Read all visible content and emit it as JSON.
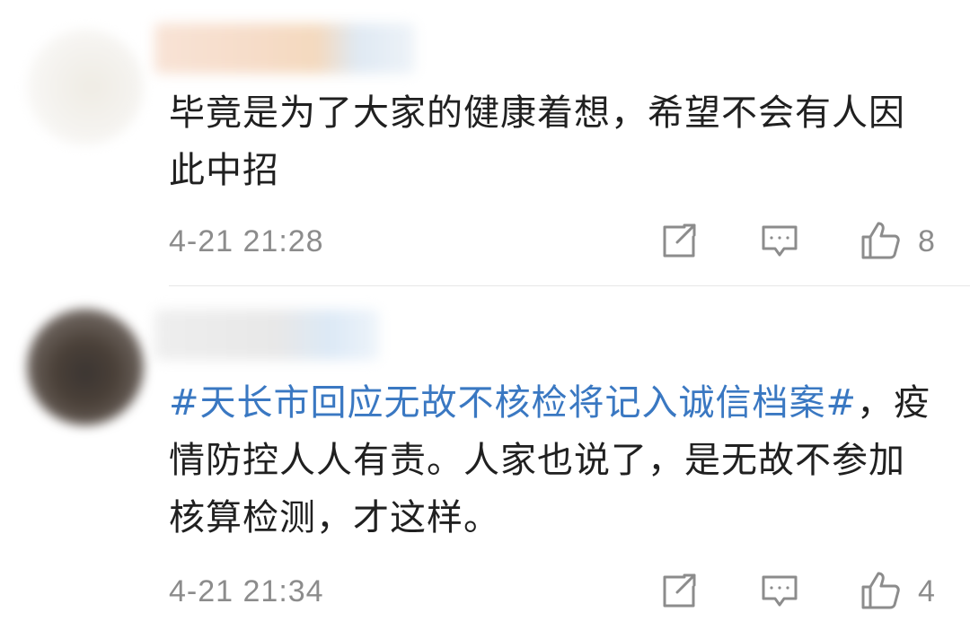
{
  "comments": [
    {
      "text": "毕竟是为了大家的健康着想，希望不会有人因此中招",
      "hashtag": "",
      "timestamp": "4-21 21:28",
      "likes": "8",
      "icons": {
        "share": "share-icon",
        "reply": "comment-icon",
        "like": "thumbs-up-icon"
      }
    },
    {
      "hashtag": "#天长市回应无故不核检将记入诚信档案#",
      "text": "，疫情防控人人有责。人家也说了，是无故不参加核算检测，才这样。",
      "timestamp": "4-21 21:34",
      "likes": "4",
      "icons": {
        "share": "share-icon",
        "reply": "comment-icon",
        "like": "thumbs-up-icon"
      }
    }
  ],
  "colors": {
    "hashtag": "#3a78c2",
    "meta_text": "#8c8c8c",
    "body_text": "#202020",
    "icon_stroke": "#8c8c8c"
  }
}
